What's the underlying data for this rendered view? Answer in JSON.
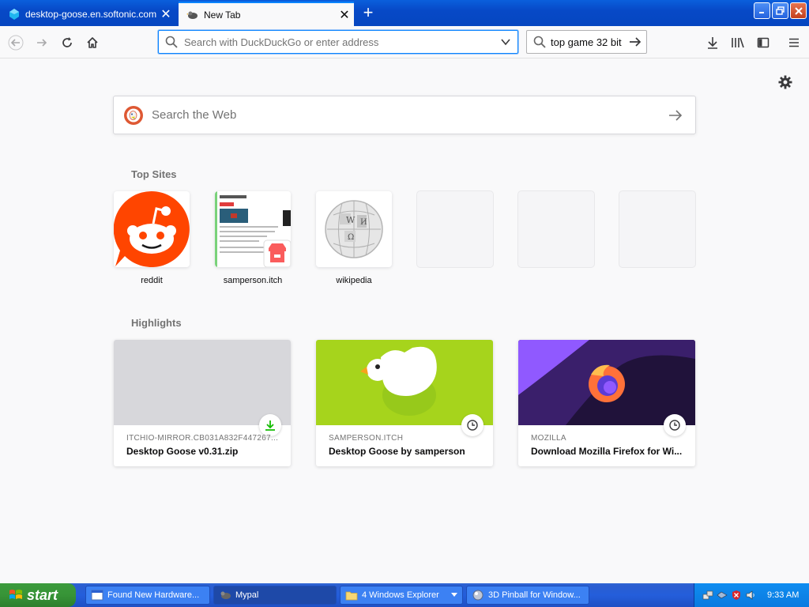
{
  "tabs": [
    {
      "title": "desktop-goose.en.softonic.com/",
      "active": false
    },
    {
      "title": "New Tab",
      "active": true
    }
  ],
  "navbar": {
    "url_placeholder": "Search with DuckDuckGo or enter address",
    "search_value": "top game 32 bit"
  },
  "content": {
    "web_search_placeholder": "Search the Web",
    "top_sites_title": "Top Sites",
    "top_sites": [
      {
        "label": "reddit"
      },
      {
        "label": "samperson.itch"
      },
      {
        "label": "wikipedia"
      }
    ],
    "highlights_title": "Highlights",
    "highlights": [
      {
        "host": "ITCHIO-MIRROR.CB031A832F447267...",
        "title": "Desktop Goose v0.31.zip",
        "badge": "download-icon"
      },
      {
        "host": "SAMPERSON.ITCH",
        "title": "Desktop Goose by samperson",
        "badge": "clock-icon"
      },
      {
        "host": "MOZILLA",
        "title": "Download Mozilla Firefox for Wi...",
        "badge": "clock-icon"
      }
    ]
  },
  "taskbar": {
    "start_label": "start",
    "tasks": [
      {
        "label": "Found New Hardware..."
      },
      {
        "label": "Mypal"
      },
      {
        "label": "4 Windows Explorer"
      },
      {
        "label": "3D Pinball for Window..."
      }
    ],
    "clock": "9:33 AM"
  },
  "colors": {
    "accent": "#0a84ff",
    "tabbar": "#0646c0",
    "download_green": "#12bc00"
  }
}
